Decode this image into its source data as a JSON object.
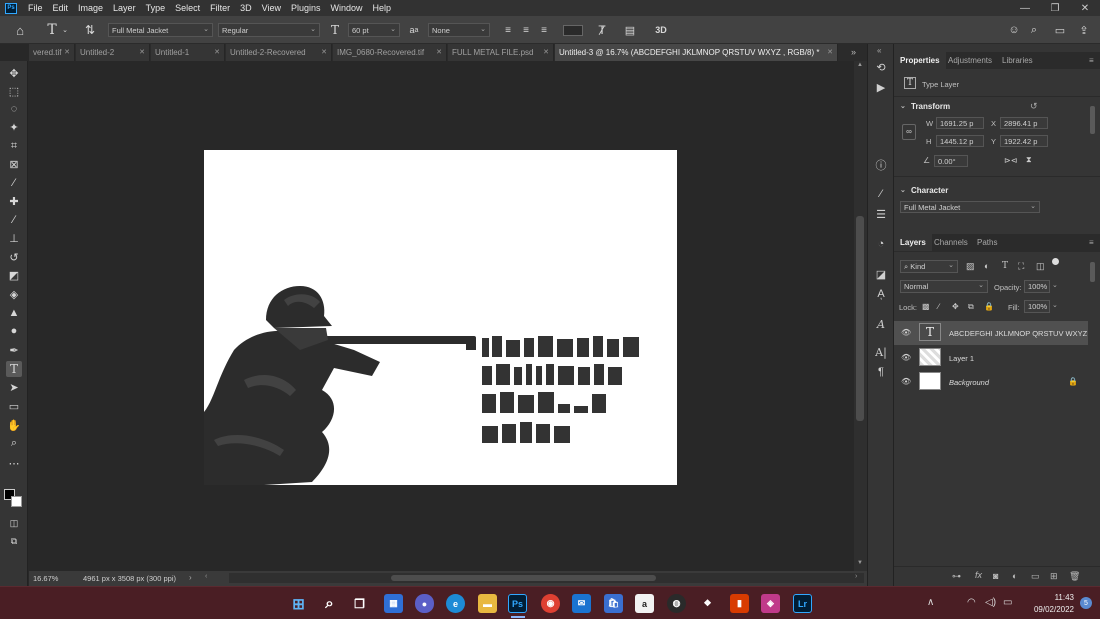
{
  "menu": {
    "app_icon": "Ps",
    "items": [
      "File",
      "Edit",
      "Image",
      "Layer",
      "Type",
      "Select",
      "Filter",
      "3D",
      "View",
      "Plugins",
      "Window",
      "Help"
    ]
  },
  "options": {
    "font_family": "Full Metal Jacket",
    "font_style": "Regular",
    "font_size": "60 pt",
    "aa_label": "a",
    "anti_alias": "None",
    "three_d": "3D"
  },
  "tabs": [
    {
      "label": "vered.tif",
      "active": false
    },
    {
      "label": "Untitled-2",
      "active": false
    },
    {
      "label": "Untitled-1",
      "active": false
    },
    {
      "label": "Untitled-2-Recovered",
      "active": false
    },
    {
      "label": "IMG_0680-Recovered.tif",
      "active": false
    },
    {
      "label": "FULL METAL FILE.psd",
      "active": false
    },
    {
      "label": "Untitled-3 @ 16.7% (ABCDEFGHI JKLMNOP QRSTUV WXYZ , RGB/8) *",
      "active": true
    }
  ],
  "status": {
    "zoom": "16.67%",
    "doc_size": "4961 px x 3508 px (300 ppi)"
  },
  "panel_tabs_top": [
    "Properties",
    "Adjustments",
    "Libraries"
  ],
  "properties": {
    "layer_type": "Type Layer",
    "transform_heading": "Transform",
    "w_label": "W",
    "w_value": "1691.25 p",
    "x_label": "X",
    "x_value": "2896.41 p",
    "h_label": "H",
    "h_value": "1445.12 p",
    "y_label": "Y",
    "y_value": "1922.42 p",
    "angle": "0.00°",
    "character_heading": "Character",
    "character_font": "Full Metal Jacket"
  },
  "panel_tabs_layers": [
    "Layers",
    "Channels",
    "Paths"
  ],
  "layers_panel": {
    "filter_kind": "Kind",
    "blend_mode": "Normal",
    "opacity_label": "Opacity:",
    "opacity_value": "100%",
    "lock_label": "Lock:",
    "fill_label": "Fill:",
    "fill_value": "100%",
    "layers": [
      {
        "name": "ABCDEFGHI JKLMNOP QRSTUV WXYZ",
        "selected": true,
        "thumb": "T"
      },
      {
        "name": "Layer 1",
        "selected": false,
        "thumb": ""
      },
      {
        "name": "Background",
        "selected": false,
        "thumb": ""
      }
    ]
  },
  "taskbar": {
    "time": "11:43",
    "date": "09/02/2022",
    "notification_count": "5",
    "apps": [
      "windows-start",
      "search",
      "task-view",
      "widgets",
      "teams-chat",
      "edge",
      "file-explorer",
      "photoshop",
      "chrome",
      "mail",
      "store",
      "amazon",
      "steam",
      "dropbox",
      "office",
      "photo-app",
      "lightroom"
    ]
  },
  "colors": {
    "accent": "#31a8ff",
    "taskbar": "#4a1e24",
    "panel": "#353535",
    "workspace": "#282828"
  }
}
